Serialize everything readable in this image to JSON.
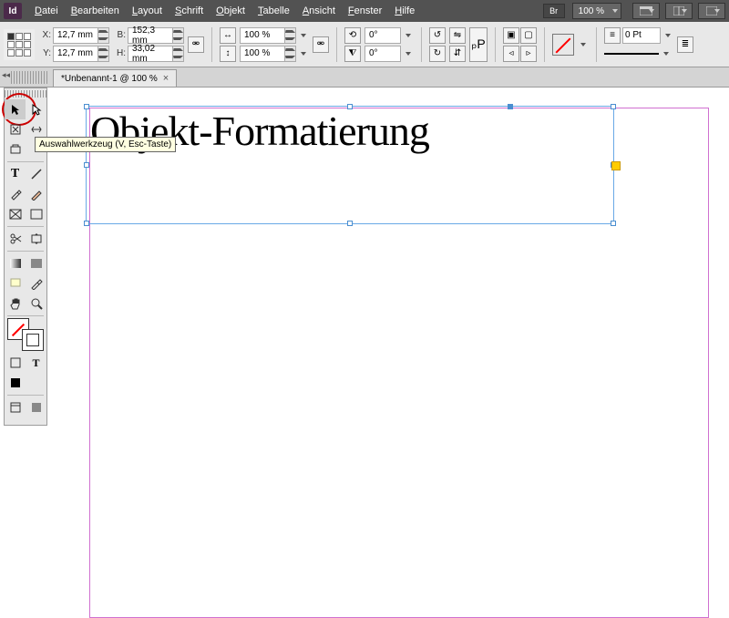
{
  "app": {
    "logo": "Id"
  },
  "menu": {
    "items": [
      "Datei",
      "Bearbeiten",
      "Layout",
      "Schrift",
      "Objekt",
      "Tabelle",
      "Ansicht",
      "Fenster",
      "Hilfe"
    ],
    "bridge": "Br",
    "zoom": "100 %"
  },
  "transform": {
    "x_label": "X:",
    "x": "12,7 mm",
    "y_label": "Y:",
    "y": "12,7 mm",
    "w_label": "B:",
    "w": "152,3 mm",
    "h_label": "H:",
    "h": "33,02 mm"
  },
  "scale": {
    "sx": "100 %",
    "sy": "100 %"
  },
  "rotate": {
    "angle": "0°",
    "shear": "0°"
  },
  "stroke": {
    "weight_label": "0 Pt"
  },
  "tab": {
    "title": "*Unbenannt-1 @ 100 %"
  },
  "document": {
    "text": "Objekt-Formatierung"
  },
  "tooltip": "Auswahlwerkzeug (V, Esc-Taste)"
}
